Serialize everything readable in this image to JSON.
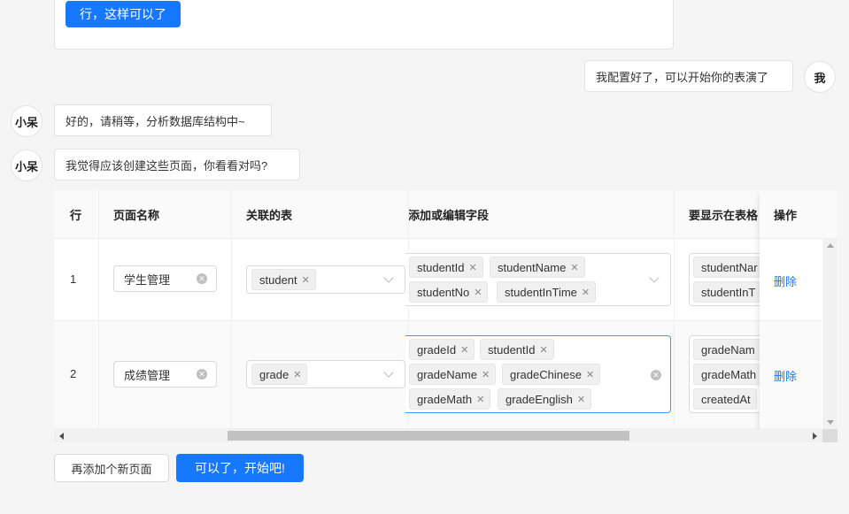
{
  "top_card": {
    "confirm_button": "行，这样可以了"
  },
  "messages": [
    {
      "sender": "我",
      "text": "我配置好了，可以开始你的表演了"
    },
    {
      "sender": "小呆",
      "text": "好的，请稍等，分析数据库结构中~"
    },
    {
      "sender": "小呆",
      "text": "我觉得应该创建这些页面，你看看对吗?"
    }
  ],
  "table": {
    "headers": {
      "row": "行",
      "page_name": "页面名称",
      "related_table": "关联的表",
      "edit_fields": "添加或编辑字段",
      "table_display": "要显示在表格",
      "actions": "操作"
    },
    "rows": [
      {
        "num": "1",
        "page_name": "学生管理",
        "related_table": "student",
        "edit_fields": [
          "studentId",
          "studentName",
          "studentNo",
          "studentInTime"
        ],
        "display_fields": [
          "studentNar",
          "studentInT"
        ],
        "action": "删除"
      },
      {
        "num": "2",
        "page_name": "成绩管理",
        "related_table": "grade",
        "edit_fields": [
          "gradeId",
          "studentId",
          "gradeName",
          "gradeChinese",
          "gradeMath",
          "gradeEnglish"
        ],
        "display_fields": [
          "gradeNam",
          "gradeMath",
          "createdAt"
        ],
        "action": "删除"
      }
    ]
  },
  "footer": {
    "add_page": "再添加个新页面",
    "start": "可以了，开始吧!"
  },
  "colors": {
    "primary": "#1677ff",
    "link": "#1677ff",
    "background": "#f5f5f5"
  },
  "icons": [
    "clear-icon",
    "chevron-down-icon",
    "tag-close-icon",
    "scroll-left-icon",
    "scroll-right-icon",
    "scroll-up-icon",
    "scroll-down-icon"
  ]
}
